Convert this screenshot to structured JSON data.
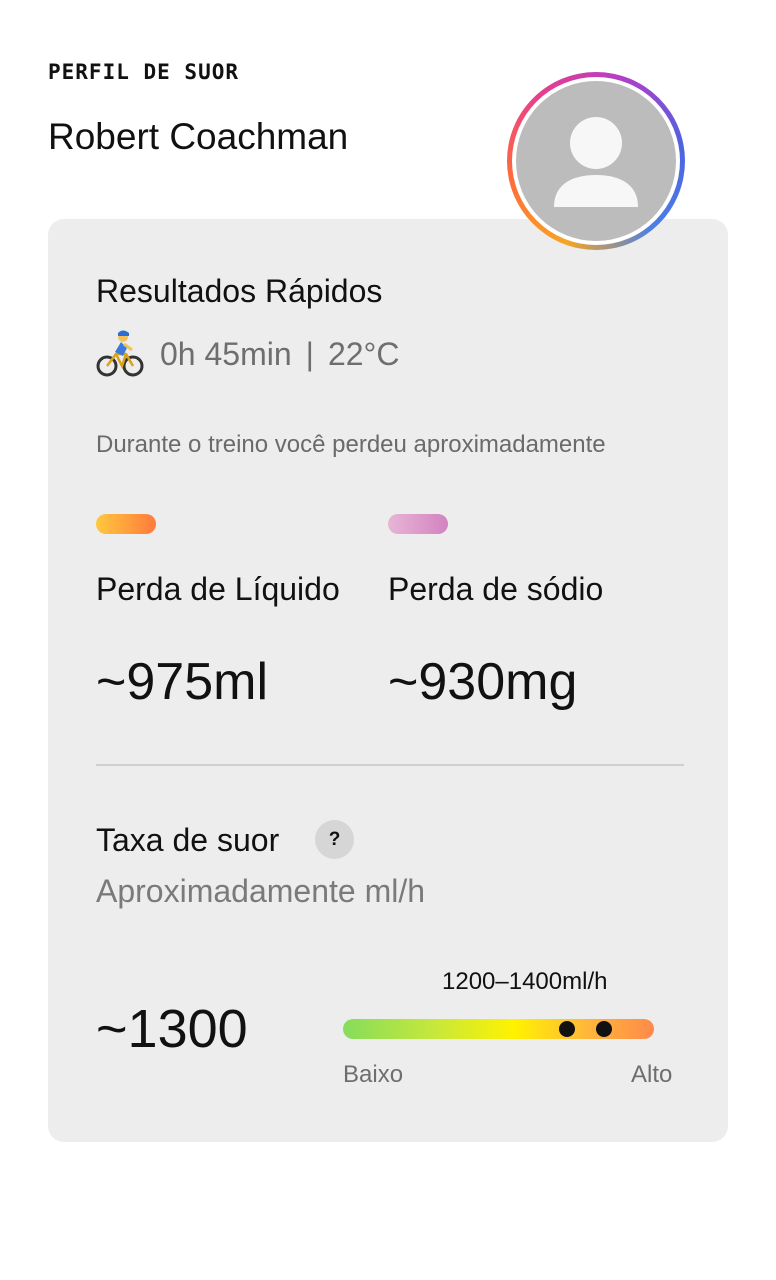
{
  "header": {
    "section_label": "PERFIL DE SUOR",
    "user_name": "Robert Coachman"
  },
  "quick_results": {
    "title": "Resultados Rápidos",
    "activity_icon": "cyclist-icon",
    "duration": "0h 45min",
    "separator": "|",
    "temperature": "22°C",
    "intro": "Durante o treino você perdeu aproximadamente"
  },
  "metrics": [
    {
      "label": "Perda de Líquido",
      "value": "~975ml",
      "color_from": "#ffc83d",
      "color_to": "#ff7a3d"
    },
    {
      "label": "Perda de sódio",
      "value": "~930mg",
      "color_from": "#e8b5d6",
      "color_to": "#d283c0"
    }
  ],
  "sweat_rate": {
    "title": "Taxa de suor",
    "help_label": "?",
    "subtitle": "Aproximadamente ml/h",
    "value": "~1300",
    "range_label": "1200–1400ml/h",
    "scale_low": "Baixo",
    "scale_high": "Alto",
    "range_low_fraction": 0.72,
    "range_high_fraction": 0.84
  },
  "colors": {
    "card_background": "#ededed",
    "avatar_ring": [
      "#f5a623",
      "#e83e8c",
      "#4d63e0"
    ]
  }
}
